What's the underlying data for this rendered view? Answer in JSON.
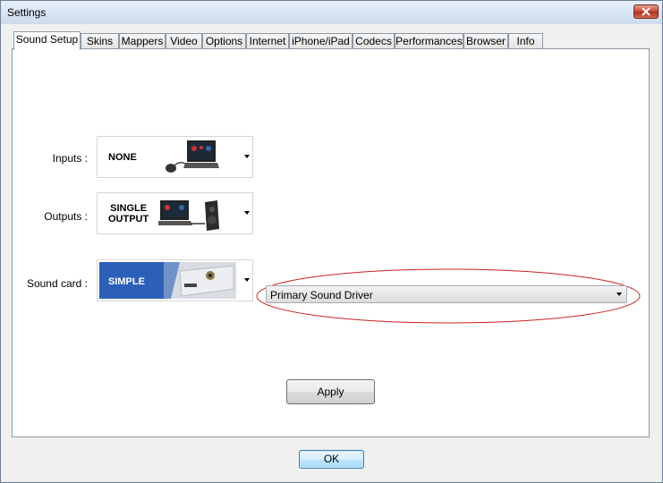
{
  "window": {
    "title": "Settings"
  },
  "tabs": [
    {
      "label": "Sound Setup",
      "active": true
    },
    {
      "label": "Skins"
    },
    {
      "label": "Mappers"
    },
    {
      "label": "Video"
    },
    {
      "label": "Options"
    },
    {
      "label": "Internet"
    },
    {
      "label": "iPhone/iPad"
    },
    {
      "label": "Codecs"
    },
    {
      "label": "Performances"
    },
    {
      "label": "Browser"
    },
    {
      "label": "Info"
    }
  ],
  "sound_setup": {
    "inputs": {
      "label": "Inputs :",
      "value": "NONE"
    },
    "outputs": {
      "label": "Outputs :",
      "value_line1": "SINGLE",
      "value_line2": "OUTPUT"
    },
    "sound_card": {
      "label": "Sound card :",
      "value": "SIMPLE"
    },
    "driver": {
      "value": "Primary Sound Driver"
    },
    "apply_label": "Apply"
  },
  "footer": {
    "ok_label": "OK"
  },
  "colors": {
    "highlight_ellipse": "#cc2222",
    "simple_card_blue": "#2b5fb8"
  }
}
